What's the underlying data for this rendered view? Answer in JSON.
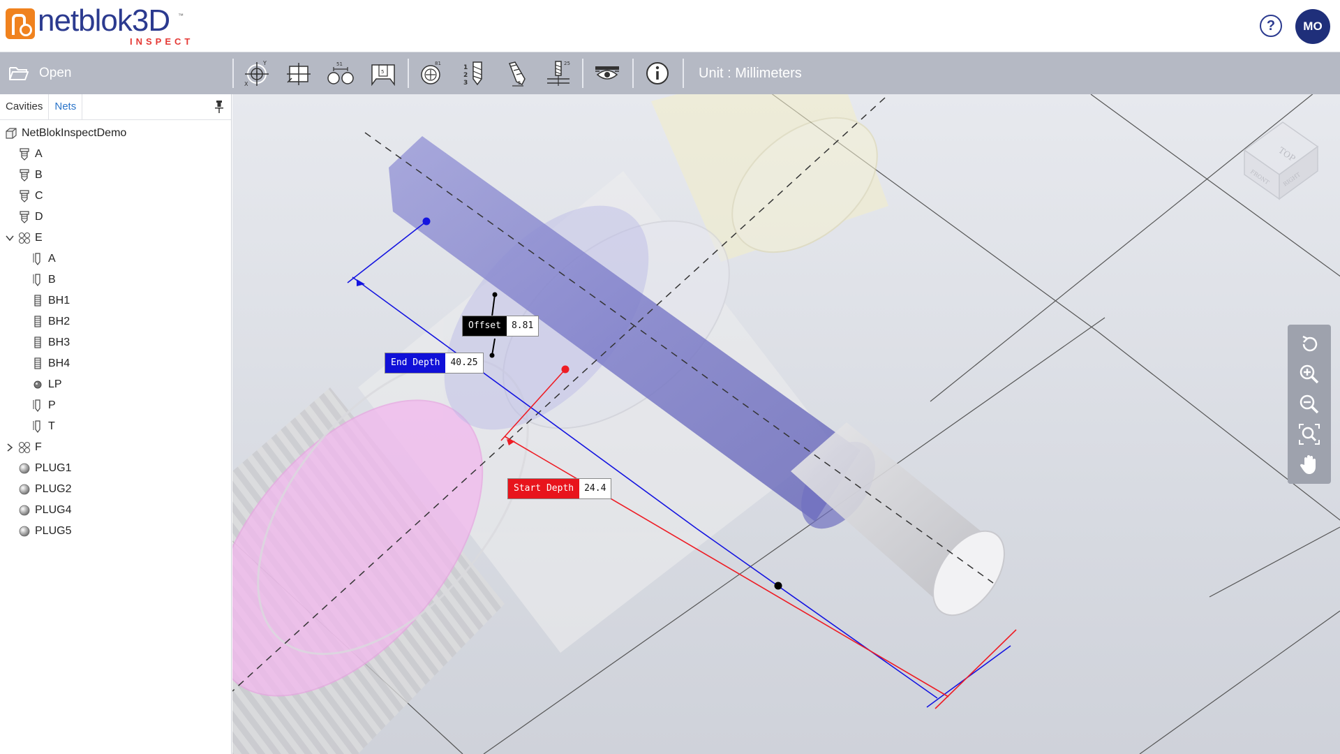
{
  "app": {
    "logo_word": "netblok3D",
    "logo_sub": "INSPECT",
    "trademark": "™"
  },
  "header": {
    "help_icon": "question-circle-icon",
    "user_initials": "MO"
  },
  "toolbar": {
    "open_label": "Open",
    "open_icon": "folder-open-icon",
    "unit_label": "Unit : Millimeters",
    "tools": [
      {
        "name": "xy-origin-tool",
        "icon": "crosshair-xy-icon"
      },
      {
        "name": "datum-box-tool",
        "icon": "crosshair-box-icon"
      },
      {
        "name": "radial-distance-tool",
        "icon": "dual-circle-distance-icon"
      },
      {
        "name": "section-tool",
        "icon": "section-plane-icon"
      },
      {
        "name": "diameter-tool",
        "icon": "crosshair-diameter-icon"
      },
      {
        "name": "drill-sequence-tool",
        "icon": "drill-123-icon"
      },
      {
        "name": "depth-gauge-tool",
        "icon": "pencil-gauge-icon"
      },
      {
        "name": "tap-depth-tool",
        "icon": "tap-depth-icon"
      },
      {
        "name": "visibility-tool",
        "icon": "eye-layer-icon"
      },
      {
        "name": "info-tool",
        "icon": "info-circle-icon"
      }
    ]
  },
  "sidebar": {
    "tabs": [
      {
        "label": "Cavities",
        "active": false
      },
      {
        "label": "Nets",
        "active": true
      }
    ],
    "pin_icon": "pin-icon",
    "tree": {
      "root": "NetBlokInspectDemo",
      "items": [
        {
          "label": "A",
          "level": 1,
          "icon": "cavity-icon"
        },
        {
          "label": "B",
          "level": 1,
          "icon": "cavity-icon"
        },
        {
          "label": "C",
          "level": 1,
          "icon": "cavity-icon"
        },
        {
          "label": "D",
          "level": 1,
          "icon": "cavity-icon"
        },
        {
          "label": "E",
          "level": 1,
          "icon": "net-group-icon",
          "expanded": true
        },
        {
          "label": "A",
          "level": 2,
          "icon": "drill-icon"
        },
        {
          "label": "B",
          "level": 2,
          "icon": "drill-icon"
        },
        {
          "label": "BH1",
          "level": 2,
          "icon": "thread-icon"
        },
        {
          "label": "BH2",
          "level": 2,
          "icon": "thread-icon"
        },
        {
          "label": "BH3",
          "level": 2,
          "icon": "thread-icon"
        },
        {
          "label": "BH4",
          "level": 2,
          "icon": "thread-icon"
        },
        {
          "label": "LP",
          "level": 2,
          "icon": "plug-small-icon"
        },
        {
          "label": "P",
          "level": 2,
          "icon": "drill-icon"
        },
        {
          "label": "T",
          "level": 2,
          "icon": "drill-icon"
        },
        {
          "label": "F",
          "level": 1,
          "icon": "net-group-icon",
          "expanded": false
        },
        {
          "label": "PLUG1",
          "level": 1,
          "icon": "sphere-icon"
        },
        {
          "label": "PLUG2",
          "level": 1,
          "icon": "sphere-icon"
        },
        {
          "label": "PLUG4",
          "level": 1,
          "icon": "sphere-icon"
        },
        {
          "label": "PLUG5",
          "level": 1,
          "icon": "sphere-icon"
        }
      ]
    }
  },
  "viewport": {
    "measurements": {
      "offset": {
        "label": "Offset",
        "value": "8.81",
        "color": "#000000"
      },
      "end_depth": {
        "label": "End Depth",
        "value": "40.25",
        "color": "#1010d8"
      },
      "start_depth": {
        "label": "Start Depth",
        "value": "24.4",
        "color": "#e8141c"
      }
    },
    "viewcube": {
      "top": "TOP",
      "front": "FRONT",
      "right": "RIGHT"
    },
    "nav_buttons": [
      {
        "name": "rotate-button",
        "icon": "rotate-icon"
      },
      {
        "name": "zoom-in-button",
        "icon": "zoom-in-icon"
      },
      {
        "name": "zoom-out-button",
        "icon": "zoom-out-icon"
      },
      {
        "name": "zoom-fit-button",
        "icon": "zoom-fit-icon"
      },
      {
        "name": "pan-button",
        "icon": "hand-pan-icon"
      }
    ]
  },
  "colors": {
    "brand_blue": "#2b3a8f",
    "brand_orange": "#f0821e",
    "toolbar_bg": "#b5b9c4",
    "tab_active": "#2a74c9"
  }
}
